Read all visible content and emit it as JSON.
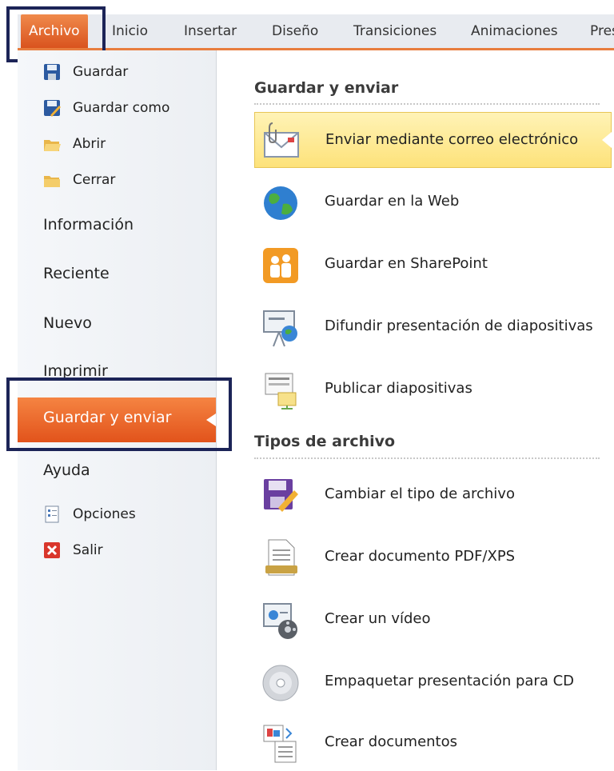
{
  "ribbon": {
    "tabs": [
      "Archivo",
      "Inicio",
      "Insertar",
      "Diseño",
      "Transiciones",
      "Animaciones",
      "Pres"
    ]
  },
  "left_menu": {
    "commands_top": [
      {
        "label": "Guardar",
        "icon": "save-icon"
      },
      {
        "label": "Guardar como",
        "icon": "save-as-icon"
      },
      {
        "label": "Abrir",
        "icon": "open-folder-icon"
      },
      {
        "label": "Cerrar",
        "icon": "close-folder-icon"
      }
    ],
    "sections": [
      "Información",
      "Reciente",
      "Nuevo",
      "Imprimir"
    ],
    "selected": "Guardar y enviar",
    "help": "Ayuda",
    "commands_bottom": [
      {
        "label": "Opciones",
        "icon": "options-icon"
      },
      {
        "label": "Salir",
        "icon": "exit-icon"
      }
    ]
  },
  "main": {
    "section1_title": "Guardar y enviar",
    "section1_items": [
      {
        "label": "Enviar mediante correo electrónico",
        "icon": "email-icon"
      },
      {
        "label": "Guardar en la Web",
        "icon": "globe-icon"
      },
      {
        "label": "Guardar en SharePoint",
        "icon": "sharepoint-icon"
      },
      {
        "label": "Difundir presentación de diapositivas",
        "icon": "broadcast-icon"
      },
      {
        "label": "Publicar diapositivas",
        "icon": "publish-slides-icon"
      }
    ],
    "section2_title": "Tipos de archivo",
    "section2_items": [
      {
        "label": "Cambiar el tipo de archivo",
        "icon": "change-file-type-icon"
      },
      {
        "label": "Crear documento PDF/XPS",
        "icon": "pdf-icon"
      },
      {
        "label": "Crear un vídeo",
        "icon": "video-icon"
      },
      {
        "label": "Empaquetar presentación para CD",
        "icon": "cd-icon"
      },
      {
        "label": "Crear documentos",
        "icon": "handouts-icon"
      }
    ]
  },
  "colors": {
    "accent": "#e2531b",
    "highlight_border": "#1c2457",
    "selected_item": "#fde27a"
  }
}
